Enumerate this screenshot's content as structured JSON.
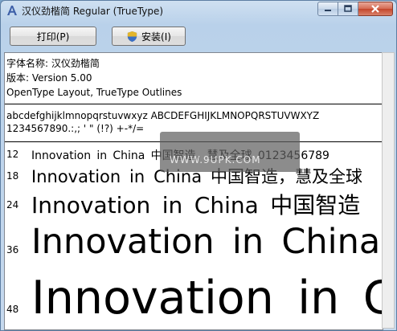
{
  "window": {
    "title": "汉仪劲楷简 Regular (TrueType)"
  },
  "toolbar": {
    "print_label": "打印(P)",
    "install_label": "安装(I)"
  },
  "font_info": {
    "name_line": "字体名称: 汉仪劲楷简",
    "version_line": "版本: Version 5.00",
    "type_line": "OpenType Layout, TrueType Outlines"
  },
  "charset": {
    "line1": "abcdefghijklmnopqrstuvwxyz  ABCDEFGHIJKLMNOPQRSTUVWXYZ",
    "line2": "1234567890.:,;  '  \"  (!?)  +-*/="
  },
  "samples": [
    {
      "size": "12",
      "text": "Innovation in China 中国智造，慧及全球 0123456789"
    },
    {
      "size": "18",
      "text": "Innovation in China 中国智造，慧及全球"
    },
    {
      "size": "24",
      "text": "Innovation in China 中国智造"
    },
    {
      "size": "36",
      "text": "Innovation in China"
    },
    {
      "size": "48",
      "text": "Innovation in C"
    }
  ],
  "watermark": {
    "text": "WWW.9UPK.COM"
  }
}
